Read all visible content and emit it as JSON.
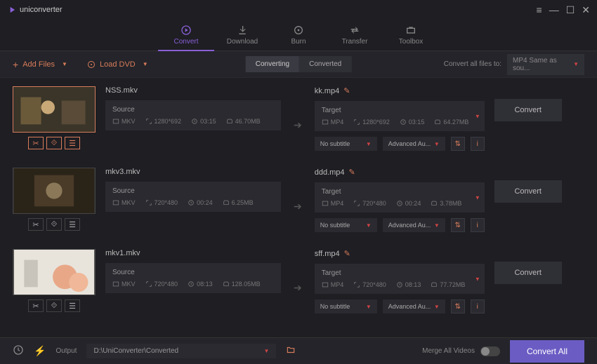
{
  "app_name": "uniconverter",
  "tabs": [
    {
      "label": "Convert",
      "active": true
    },
    {
      "label": "Download",
      "active": false
    },
    {
      "label": "Burn",
      "active": false
    },
    {
      "label": "Transfer",
      "active": false
    },
    {
      "label": "Toolbox",
      "active": false
    }
  ],
  "toolbar": {
    "add_files": "Add Files",
    "load_dvd": "Load DVD",
    "subtab_converting": "Converting",
    "subtab_converted": "Converted",
    "convert_to_label": "Convert all files to:",
    "format": "MP4 Same as sou..."
  },
  "items": [
    {
      "src_name": "NSS.mkv",
      "src_format": "MKV",
      "src_res": "1280*692",
      "src_dur": "03:15",
      "src_size": "46.70MB",
      "tgt_name": "kk.mp4",
      "tgt_format": "MP4",
      "tgt_res": "1280*692",
      "tgt_dur": "03:15",
      "tgt_size": "64.27MB",
      "subtitle": "No subtitle",
      "audio": "Advanced Au...",
      "active": true
    },
    {
      "src_name": "mkv3.mkv",
      "src_format": "MKV",
      "src_res": "720*480",
      "src_dur": "00:24",
      "src_size": "6.25MB",
      "tgt_name": "ddd.mp4",
      "tgt_format": "MP4",
      "tgt_res": "720*480",
      "tgt_dur": "00:24",
      "tgt_size": "3.78MB",
      "subtitle": "No subtitle",
      "audio": "Advanced Au...",
      "active": false
    },
    {
      "src_name": "mkv1.mkv",
      "src_format": "MKV",
      "src_res": "720*480",
      "src_dur": "08:13",
      "src_size": "128.05MB",
      "tgt_name": "sff.mp4",
      "tgt_format": "MP4",
      "tgt_res": "720*480",
      "tgt_dur": "08:13",
      "tgt_size": "77.72MB",
      "subtitle": "No subtitle",
      "audio": "Advanced Au...",
      "active": false
    }
  ],
  "labels": {
    "source": "Source",
    "target": "Target",
    "convert": "Convert"
  },
  "footer": {
    "output_label": "Output",
    "output_path": "D:\\UniConverter\\Converted",
    "merge_label": "Merge All Videos",
    "convert_all": "Convert All"
  }
}
